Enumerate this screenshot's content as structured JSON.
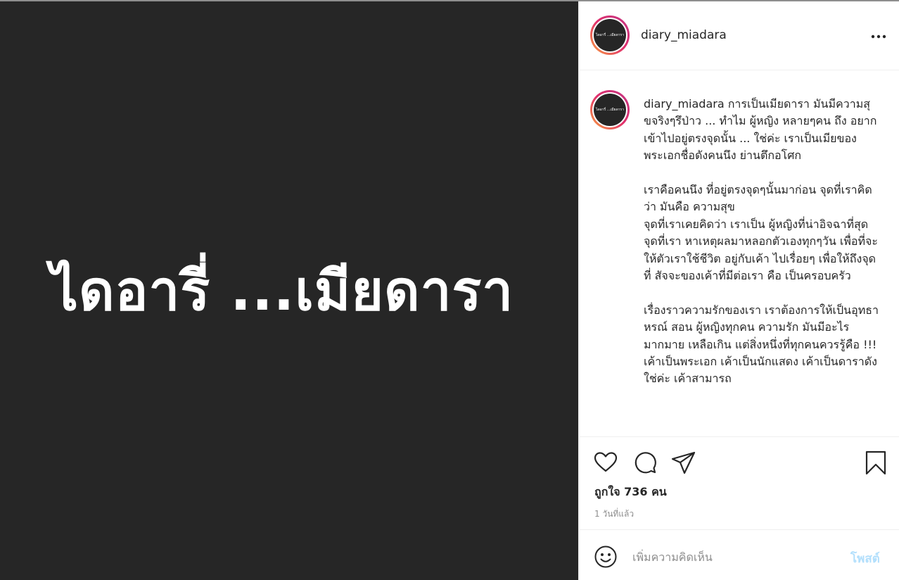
{
  "post": {
    "image_text": "ไดอารี่ ...เมียดารา",
    "avatar_text": "ไดอารี่ ...เมียดารา"
  },
  "header": {
    "username": "diary_miadara",
    "more_icon": "more-horizontal-icon"
  },
  "caption": {
    "username": "diary_miadara",
    "paragraphs": [
      "การเป็นเมียดารา มันมีความสุขจริงๆรึป่าว ... ทำไม ผู้หญิง หลายๆคน ถึง อยากเข้าไปอยู่ตรงจุดนั้น ... ใช่ค่ะ เราเป็นเมียของพระเอกชื่อดังคนนึง ย่านตึกอโศก",
      "เราคือคนนึง ที่อยู่ตรงจุดๆนั้นมาก่อน จุดที่เราคิดว่า มันคือ ความสุข\nจุดที่เราเคยคิดว่า เราเป็น ผู้หญิงที่น่าอิจฉาที่สุด\nจุดที่เรา หาเหตุผลมาหลอกตัวเองทุกๆวัน เพื่อที่จะให้ตัวเราใช้ชีวิต อยู่กับเค้า ไปเรื่อยๆ เพื่อให้ถึงจุดที่ สัจจะของเค้าที่มีต่อเรา คือ เป็นครอบครัว",
      "เรื่องราวความรักของเรา เราต้องการให้เป็นอุทธาหรณ์ สอน ผู้หญิงทุกคน ความรัก มันมีอะไรมากมาย เหลือเกิน แต่สิ่งหนึ่งที่ทุกคนควรรู้คือ !!! เค้าเป็นพระเอก เค้าเป็นนักแสดง เค้าเป็นดาราดัง ใช่ค่ะ เค้าสามารถ"
    ]
  },
  "actions": {
    "like_icon": "heart-icon",
    "comment_icon": "comment-icon",
    "share_icon": "share-icon",
    "save_icon": "bookmark-icon",
    "likes_text": "ถูกใจ 736 คน",
    "time_ago": "1 วันที่แล้ว"
  },
  "comment_bar": {
    "emoji_icon": "emoji-icon",
    "placeholder": "เพิ่มความคิดเห็น",
    "post_label": "โพสต์"
  },
  "colors": {
    "image_bg": "#262626",
    "post_button_disabled": "#b2dffc",
    "story_ring": "#e1306c"
  }
}
